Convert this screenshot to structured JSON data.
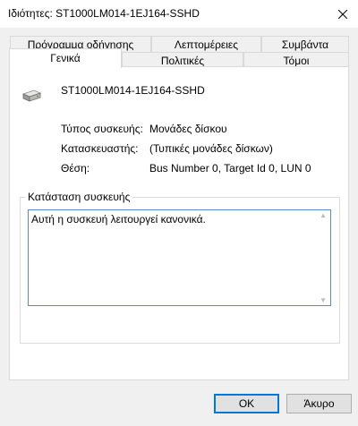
{
  "window": {
    "title": "Ιδιότητες: ST1000LM014-1EJ164-SSHD",
    "close_icon": "close-icon"
  },
  "tabs_top": [
    {
      "label": "Πρόγραμμα οδήγησης"
    },
    {
      "label": "Λεπτομέρειες"
    },
    {
      "label": "Συμβάντα"
    }
  ],
  "tabs_bottom": [
    {
      "label": "Γενικά",
      "active": true
    },
    {
      "label": "Πολιτικές"
    },
    {
      "label": "Τόμοι"
    }
  ],
  "device": {
    "icon": "disk-drive-icon",
    "name": "ST1000LM014-1EJ164-SSHD",
    "properties": [
      {
        "label": "Τύπος συσκευής:",
        "value": "Μονάδες δίσκου"
      },
      {
        "label": "Κατασκευαστής:",
        "value": "(Τυπικές μονάδες δίσκων)"
      },
      {
        "label": "Θέση:",
        "value": "Bus Number 0, Target Id 0, LUN 0"
      }
    ]
  },
  "status": {
    "group_label": "Κατάσταση συσκευής",
    "text": "Αυτή η συσκευή λειτουργεί κανονικά."
  },
  "buttons": {
    "ok": "OK",
    "cancel": "Άκυρο"
  },
  "colors": {
    "accent": "#0078d7",
    "focus_border": "#5b87d4"
  }
}
